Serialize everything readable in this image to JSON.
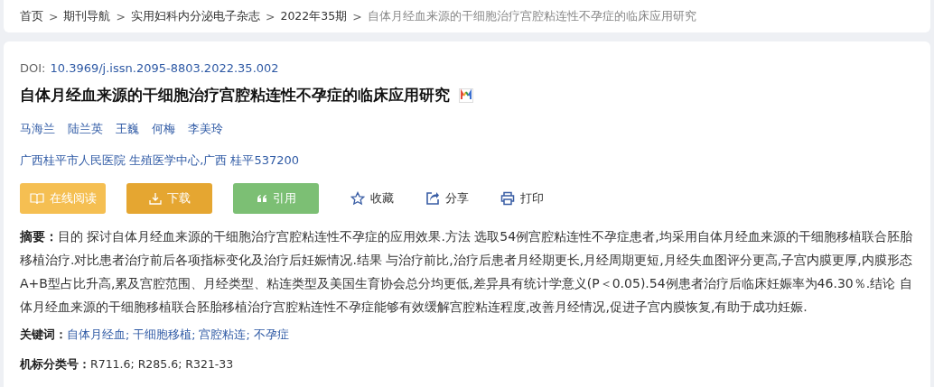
{
  "breadcrumb": [
    {
      "label": "首页",
      "current": false
    },
    {
      "label": "期刊导航",
      "current": false
    },
    {
      "label": "实用妇科内分泌电子杂志",
      "current": false
    },
    {
      "label": "2022年35期",
      "current": false
    },
    {
      "label": "自体月经血来源的干细胞治疗宫腔粘连性不孕症的临床应用研究",
      "current": true
    }
  ],
  "breadcrumb_separator": ">",
  "doi": {
    "label": "DOI:",
    "value": "10.3969/j.issn.2095-8803.2022.35.002"
  },
  "title": "自体月经血来源的干细胞治疗宫腔粘连性不孕症的临床应用研究",
  "authors": [
    "马海兰",
    "陆兰英",
    "王巍",
    "何梅",
    "李美玲"
  ],
  "affiliation": "广西桂平市人民医院 生殖医学中心,广西 桂平537200",
  "buttons": [
    {
      "label": "在线阅读",
      "kind": "read",
      "color": "#f5bf52"
    },
    {
      "label": "下载",
      "kind": "download",
      "color": "#e5a631"
    },
    {
      "label": "引用",
      "kind": "cite",
      "color": "#7cbf74"
    }
  ],
  "actions": [
    {
      "label": "收藏",
      "kind": "star"
    },
    {
      "label": "分享",
      "kind": "share"
    },
    {
      "label": "打印",
      "kind": "print"
    }
  ],
  "abstract": "**摘要：**目的 探讨自体月经血来源的干细胞治疗宫腔粘连性不孕症的应用效果.方法 选取54例宫腔粘连性不孕症患者,均采用自体月经血来源的干细胞移植联合胚胎移植治疗.对比患者治疗前后各项指标变化及治疗后妊娠情况.结果 与治疗前比,治疗后患者月经期更长,月经周期更短,月经失血图评分更高,子宫内膜更厚,内膜形态A+B型占比升高,累及宫腔范围、月经类型、粘连类型及美国生育协会总分均更低,差异具有统计学意义(P＜0.05).54例患者治疗后临床妊娠率为46.30％.结论 自体月经血来源的干细胞移植联合胚胎移植治疗宫腔粘连性不孕症能够有效缓解宫腔粘连程度,改善月经情况,促进子宫内膜恢复,有助于成功妊娠.",
  "keywords": {
    "label": "关键词：",
    "separator": ";",
    "items": [
      "自体月经血",
      "干细胞移植",
      "宫腔粘连",
      "不孕症"
    ]
  },
  "classification": {
    "label": "机标分类号：",
    "value": "R711.6; R285.6; R321-33"
  }
}
